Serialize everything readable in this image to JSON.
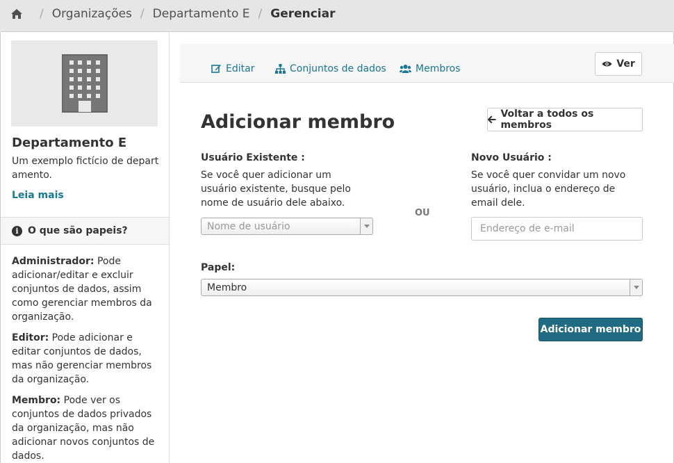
{
  "breadcrumb": {
    "items": [
      "Organizações",
      "Departamento E",
      "Gerenciar"
    ]
  },
  "sidebar": {
    "title": "Departamento E",
    "description": "Um exemplo fictício de departamento.",
    "read_more": "Leia mais",
    "roles_heading": "O que são papeis?",
    "roles": [
      {
        "name": "Administrador:",
        "text": " Pode adicionar/editar e excluir conjuntos de dados, assim como gerenciar membros da organização."
      },
      {
        "name": "Editor:",
        "text": " Pode adicionar e editar conjuntos de dados, mas não gerenciar membros da organização."
      },
      {
        "name": "Membro:",
        "text": " Pode ver os conjuntos de dados privados da organização, mas não adicionar novos conjuntos de dados."
      }
    ]
  },
  "tabs": {
    "edit": "Editar",
    "datasets": "Conjuntos de dados",
    "members": "Membros"
  },
  "view_button": "Ver",
  "main": {
    "title": "Adicionar membro",
    "back_button": "Voltar a todos os membros",
    "existing_label": "Usuário Existente :",
    "existing_help": "Se você quer adicionar um usuário existente, busque pelo nome de usuário dele abaixo.",
    "username_placeholder": "Nome de usuário",
    "or_label": "OU",
    "new_label": "Novo Usuário :",
    "new_help": "Se você quer convidar um novo usuário, inclua o endereço de email dele.",
    "email_placeholder": "Endereço de e-mail",
    "role_label": "Papel:",
    "role_value": "Membro",
    "submit": "Adicionar membro"
  },
  "colors": {
    "link": "#187794",
    "primary": "#206b82"
  }
}
